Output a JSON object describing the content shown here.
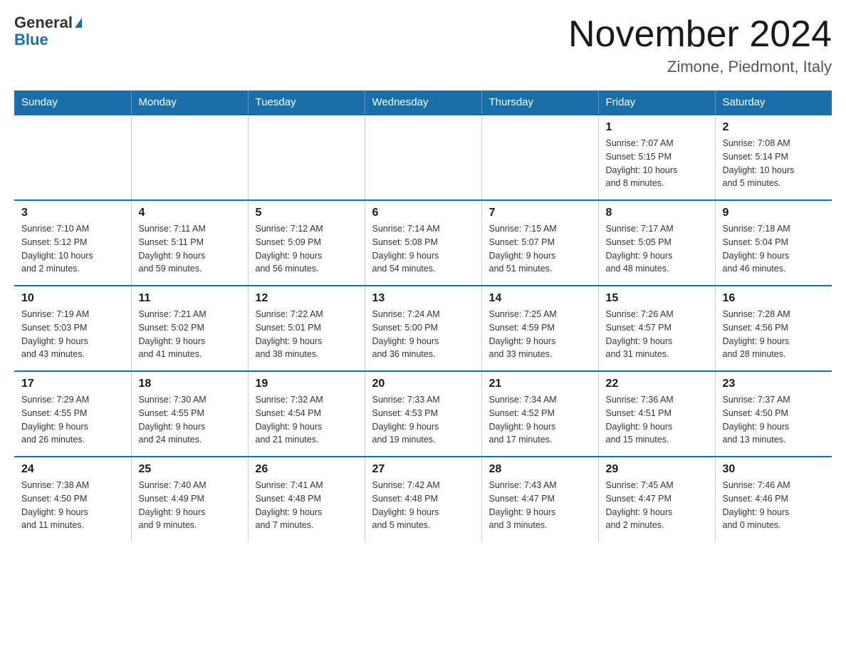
{
  "header": {
    "logo_general": "General",
    "logo_blue": "Blue",
    "month_title": "November 2024",
    "location": "Zimone, Piedmont, Italy"
  },
  "days_of_week": [
    "Sunday",
    "Monday",
    "Tuesday",
    "Wednesday",
    "Thursday",
    "Friday",
    "Saturday"
  ],
  "weeks": [
    [
      {
        "day": "",
        "info": ""
      },
      {
        "day": "",
        "info": ""
      },
      {
        "day": "",
        "info": ""
      },
      {
        "day": "",
        "info": ""
      },
      {
        "day": "",
        "info": ""
      },
      {
        "day": "1",
        "info": "Sunrise: 7:07 AM\nSunset: 5:15 PM\nDaylight: 10 hours\nand 8 minutes."
      },
      {
        "day": "2",
        "info": "Sunrise: 7:08 AM\nSunset: 5:14 PM\nDaylight: 10 hours\nand 5 minutes."
      }
    ],
    [
      {
        "day": "3",
        "info": "Sunrise: 7:10 AM\nSunset: 5:12 PM\nDaylight: 10 hours\nand 2 minutes."
      },
      {
        "day": "4",
        "info": "Sunrise: 7:11 AM\nSunset: 5:11 PM\nDaylight: 9 hours\nand 59 minutes."
      },
      {
        "day": "5",
        "info": "Sunrise: 7:12 AM\nSunset: 5:09 PM\nDaylight: 9 hours\nand 56 minutes."
      },
      {
        "day": "6",
        "info": "Sunrise: 7:14 AM\nSunset: 5:08 PM\nDaylight: 9 hours\nand 54 minutes."
      },
      {
        "day": "7",
        "info": "Sunrise: 7:15 AM\nSunset: 5:07 PM\nDaylight: 9 hours\nand 51 minutes."
      },
      {
        "day": "8",
        "info": "Sunrise: 7:17 AM\nSunset: 5:05 PM\nDaylight: 9 hours\nand 48 minutes."
      },
      {
        "day": "9",
        "info": "Sunrise: 7:18 AM\nSunset: 5:04 PM\nDaylight: 9 hours\nand 46 minutes."
      }
    ],
    [
      {
        "day": "10",
        "info": "Sunrise: 7:19 AM\nSunset: 5:03 PM\nDaylight: 9 hours\nand 43 minutes."
      },
      {
        "day": "11",
        "info": "Sunrise: 7:21 AM\nSunset: 5:02 PM\nDaylight: 9 hours\nand 41 minutes."
      },
      {
        "day": "12",
        "info": "Sunrise: 7:22 AM\nSunset: 5:01 PM\nDaylight: 9 hours\nand 38 minutes."
      },
      {
        "day": "13",
        "info": "Sunrise: 7:24 AM\nSunset: 5:00 PM\nDaylight: 9 hours\nand 36 minutes."
      },
      {
        "day": "14",
        "info": "Sunrise: 7:25 AM\nSunset: 4:59 PM\nDaylight: 9 hours\nand 33 minutes."
      },
      {
        "day": "15",
        "info": "Sunrise: 7:26 AM\nSunset: 4:57 PM\nDaylight: 9 hours\nand 31 minutes."
      },
      {
        "day": "16",
        "info": "Sunrise: 7:28 AM\nSunset: 4:56 PM\nDaylight: 9 hours\nand 28 minutes."
      }
    ],
    [
      {
        "day": "17",
        "info": "Sunrise: 7:29 AM\nSunset: 4:55 PM\nDaylight: 9 hours\nand 26 minutes."
      },
      {
        "day": "18",
        "info": "Sunrise: 7:30 AM\nSunset: 4:55 PM\nDaylight: 9 hours\nand 24 minutes."
      },
      {
        "day": "19",
        "info": "Sunrise: 7:32 AM\nSunset: 4:54 PM\nDaylight: 9 hours\nand 21 minutes."
      },
      {
        "day": "20",
        "info": "Sunrise: 7:33 AM\nSunset: 4:53 PM\nDaylight: 9 hours\nand 19 minutes."
      },
      {
        "day": "21",
        "info": "Sunrise: 7:34 AM\nSunset: 4:52 PM\nDaylight: 9 hours\nand 17 minutes."
      },
      {
        "day": "22",
        "info": "Sunrise: 7:36 AM\nSunset: 4:51 PM\nDaylight: 9 hours\nand 15 minutes."
      },
      {
        "day": "23",
        "info": "Sunrise: 7:37 AM\nSunset: 4:50 PM\nDaylight: 9 hours\nand 13 minutes."
      }
    ],
    [
      {
        "day": "24",
        "info": "Sunrise: 7:38 AM\nSunset: 4:50 PM\nDaylight: 9 hours\nand 11 minutes."
      },
      {
        "day": "25",
        "info": "Sunrise: 7:40 AM\nSunset: 4:49 PM\nDaylight: 9 hours\nand 9 minutes."
      },
      {
        "day": "26",
        "info": "Sunrise: 7:41 AM\nSunset: 4:48 PM\nDaylight: 9 hours\nand 7 minutes."
      },
      {
        "day": "27",
        "info": "Sunrise: 7:42 AM\nSunset: 4:48 PM\nDaylight: 9 hours\nand 5 minutes."
      },
      {
        "day": "28",
        "info": "Sunrise: 7:43 AM\nSunset: 4:47 PM\nDaylight: 9 hours\nand 3 minutes."
      },
      {
        "day": "29",
        "info": "Sunrise: 7:45 AM\nSunset: 4:47 PM\nDaylight: 9 hours\nand 2 minutes."
      },
      {
        "day": "30",
        "info": "Sunrise: 7:46 AM\nSunset: 4:46 PM\nDaylight: 9 hours\nand 0 minutes."
      }
    ]
  ]
}
